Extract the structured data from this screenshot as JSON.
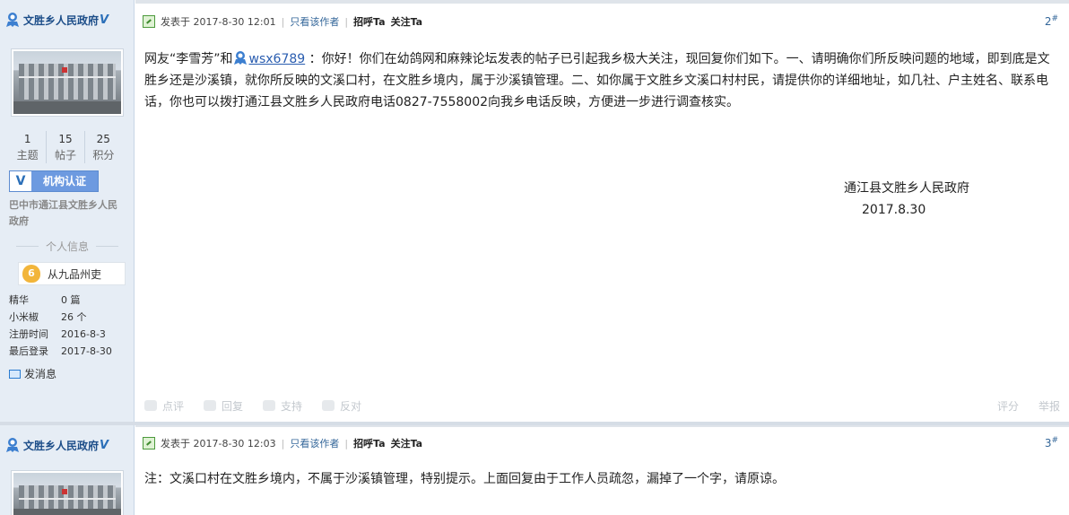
{
  "posts": [
    {
      "author": {
        "name": "文胜乡人民政府",
        "verified_mark": "V",
        "stats": [
          {
            "value": "1",
            "label": "主题"
          },
          {
            "value": "15",
            "label": "帖子"
          },
          {
            "value": "25",
            "label": "积分"
          }
        ],
        "verify_badge": {
          "icon": "V",
          "label": "机构认证"
        },
        "org": "巴中市通江县文胜乡人民政府",
        "info_title": "个人信息",
        "rank": {
          "level": "6",
          "title": "从九品州吏"
        },
        "info": [
          {
            "key": "精华",
            "value": "0 篇"
          },
          {
            "key": "小米椒",
            "value": "26 个"
          },
          {
            "key": "注册时间",
            "value": "2016-8-3"
          },
          {
            "key": "最后登录",
            "value": "2017-8-30"
          }
        ],
        "send_msg": "发消息"
      },
      "meta": {
        "posted_at": "发表于 2017-8-30 12:01",
        "only_author": "只看该作者",
        "greet": "招呼Ta",
        "follow": "关注Ta",
        "floor": "2",
        "floor_mark": "#"
      },
      "content": {
        "prefix": "网友“李雪芳”和",
        "mention": "wsx6789",
        "body": " ：你好！你们在幼鸽网和麻辣论坛发表的帖子已引起我乡极大关注，现回复你们如下。一、请明确你们所反映问题的地域，即到底是文胜乡还是沙溪镇，就你所反映的文溪口村，在文胜乡境内，属于沙溪镇管理。二、如你属于文胜乡文溪口村村民，请提供你的详细地址，如几社、户主姓名、联系电话，你也可以拨打通江县文胜乡人民政府电话0827-7558002向我乡电话反映，方便进一步进行调查核实。",
        "signature_org": "通江县文胜乡人民政府",
        "signature_date": "2017.8.30"
      },
      "actions": {
        "rate": "点评",
        "reply": "回复",
        "support": "支持",
        "oppose": "反对",
        "score": "评分",
        "report": "举报"
      }
    },
    {
      "author": {
        "name": "文胜乡人民政府",
        "verified_mark": "V"
      },
      "meta": {
        "posted_at": "发表于 2017-8-30 12:03",
        "only_author": "只看该作者",
        "greet": "招呼Ta",
        "follow": "关注Ta",
        "floor": "3",
        "floor_mark": "#"
      },
      "content": {
        "body": "注：文溪口村在文胜乡境内，不属于沙溪镇管理，特别提示。上面回复由于工作人员疏忽，漏掉了一个字，请原谅。"
      }
    }
  ]
}
